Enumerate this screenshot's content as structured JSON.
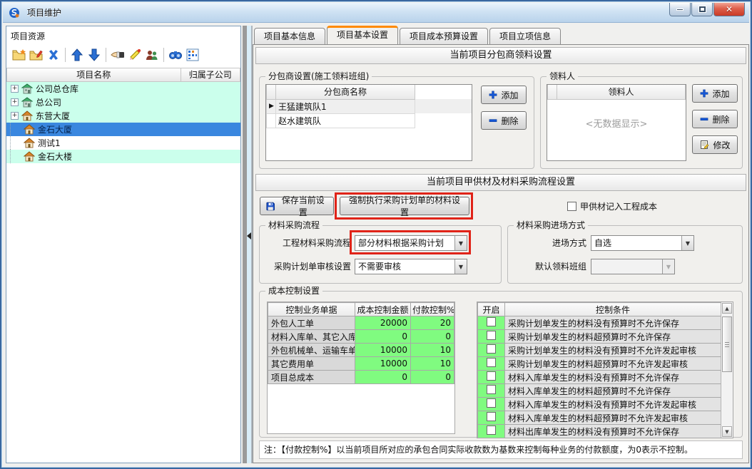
{
  "window": {
    "title": "项目维护",
    "controls": {
      "minimize": "minimize",
      "maximize": "maximize",
      "close": "close"
    }
  },
  "left_panel": {
    "title": "项目资源",
    "toolbar": [
      {
        "name": "add-folder",
        "sep_after": false
      },
      {
        "name": "edit-folder",
        "sep_after": false
      },
      {
        "name": "delete",
        "sep_after": true
      },
      {
        "name": "move-up",
        "sep_after": false
      },
      {
        "name": "move-down",
        "sep_after": true
      },
      {
        "name": "assign",
        "sep_after": false
      },
      {
        "name": "erase",
        "sep_after": false
      },
      {
        "name": "members",
        "sep_after": true
      },
      {
        "name": "search",
        "sep_after": false
      },
      {
        "name": "columns",
        "sep_after": false
      }
    ],
    "columns": [
      "项目名称",
      "归属子公司"
    ],
    "tree": [
      {
        "label": "公司总仓库",
        "icon": "warehouse",
        "expander": true,
        "child": false,
        "bg": "cyan",
        "selected": false
      },
      {
        "label": "总公司",
        "icon": "warehouse",
        "expander": true,
        "child": false,
        "bg": "cyan",
        "selected": false
      },
      {
        "label": "东营大厦",
        "icon": "house",
        "expander": true,
        "child": false,
        "bg": "cyan",
        "selected": false
      },
      {
        "label": "金石大厦",
        "icon": "house",
        "expander": false,
        "child": true,
        "bg": "sel",
        "selected": true
      },
      {
        "label": "测试1",
        "icon": "house",
        "expander": false,
        "child": true,
        "bg": "white",
        "selected": false
      },
      {
        "label": "金石大楼",
        "icon": "house",
        "expander": false,
        "child": true,
        "bg": "cyan",
        "selected": false
      }
    ]
  },
  "tabs": [
    {
      "label": "项目基本信息",
      "active": false
    },
    {
      "label": "项目基本设置",
      "active": true
    },
    {
      "label": "项目成本预算设置",
      "active": false
    },
    {
      "label": "项目立项信息",
      "active": false
    }
  ],
  "section1": {
    "header": "当前项目分包商领料设置",
    "subcontractor_group": {
      "legend": "分包商设置(施工领料班组)",
      "column": "分包商名称",
      "rows": [
        "王猛建筑队1",
        "赵水建筑队"
      ],
      "add_label": "添加",
      "delete_label": "删除"
    },
    "picker_group": {
      "legend": "领料人",
      "column": "领料人",
      "empty_text": "<无数据显示>",
      "add_label": "添加",
      "delete_label": "删除",
      "modify_label": "修改"
    }
  },
  "section2": {
    "header": "当前项目甲供材及材料采购流程设置",
    "save_button": "保存当前设置",
    "force_button": "强制执行采购计划单的材料设置",
    "owner_checkbox_label": "甲供材记入工程成本",
    "procurement_group": {
      "legend": "材料采购流程",
      "row1_label": "工程材料采购流程",
      "row1_value": "部分材料根据采购计划",
      "row2_label": "采购计划单审核设置",
      "row2_value": "不需要审核"
    },
    "entry_group": {
      "legend": "材料采购进场方式",
      "row1_label": "进场方式",
      "row1_value": "自选",
      "row2_label": "默认领料班组",
      "row2_value": ""
    }
  },
  "cost_group": {
    "legend": "成本控制设置",
    "left_table": {
      "headers": [
        "控制业务单据",
        "成本控制金额",
        "付款控制%"
      ],
      "rows": [
        {
          "name": "外包人工单",
          "amount": "20000",
          "pay": "20"
        },
        {
          "name": "材料入库单、其它入库单",
          "amount": "0",
          "pay": "0"
        },
        {
          "name": "外包机械单、运输车单",
          "amount": "10000",
          "pay": "10"
        },
        {
          "name": "其它费用单",
          "amount": "10000",
          "pay": "10"
        },
        {
          "name": "项目总成本",
          "amount": "0",
          "pay": "0"
        }
      ]
    },
    "right_table": {
      "headers": [
        "开启",
        "控制条件"
      ],
      "rows": [
        "采购计划单发生的材料没有预算时不允许保存",
        "采购计划单发生的材料超预算时不允许保存",
        "采购计划单发生的材料没有预算时不允许发起审核",
        "采购计划单发生的材料超预算时不允许发起审核",
        "材料入库单发生的材料没有预算时不允许保存",
        "材料入库单发生的材料超预算时不允许保存",
        "材料入库单发生的材料没有预算时不允许发起审核",
        "材料入库单发生的材料超预算时不允许发起审核",
        "材料出库单发生的材料没有预算时不允许保存"
      ]
    }
  },
  "note": "注：【付款控制%】以当前项目所对应的承包合同实际收款数为基数来控制每种业务的付款额度，为0表示不控制。",
  "colors": {
    "tab_accent": "#ff8a00",
    "selection_blue": "#3a87df",
    "tree_cyan": "#cbffec",
    "grid_green": "#80fb80",
    "annotation_red": "#e02318"
  }
}
